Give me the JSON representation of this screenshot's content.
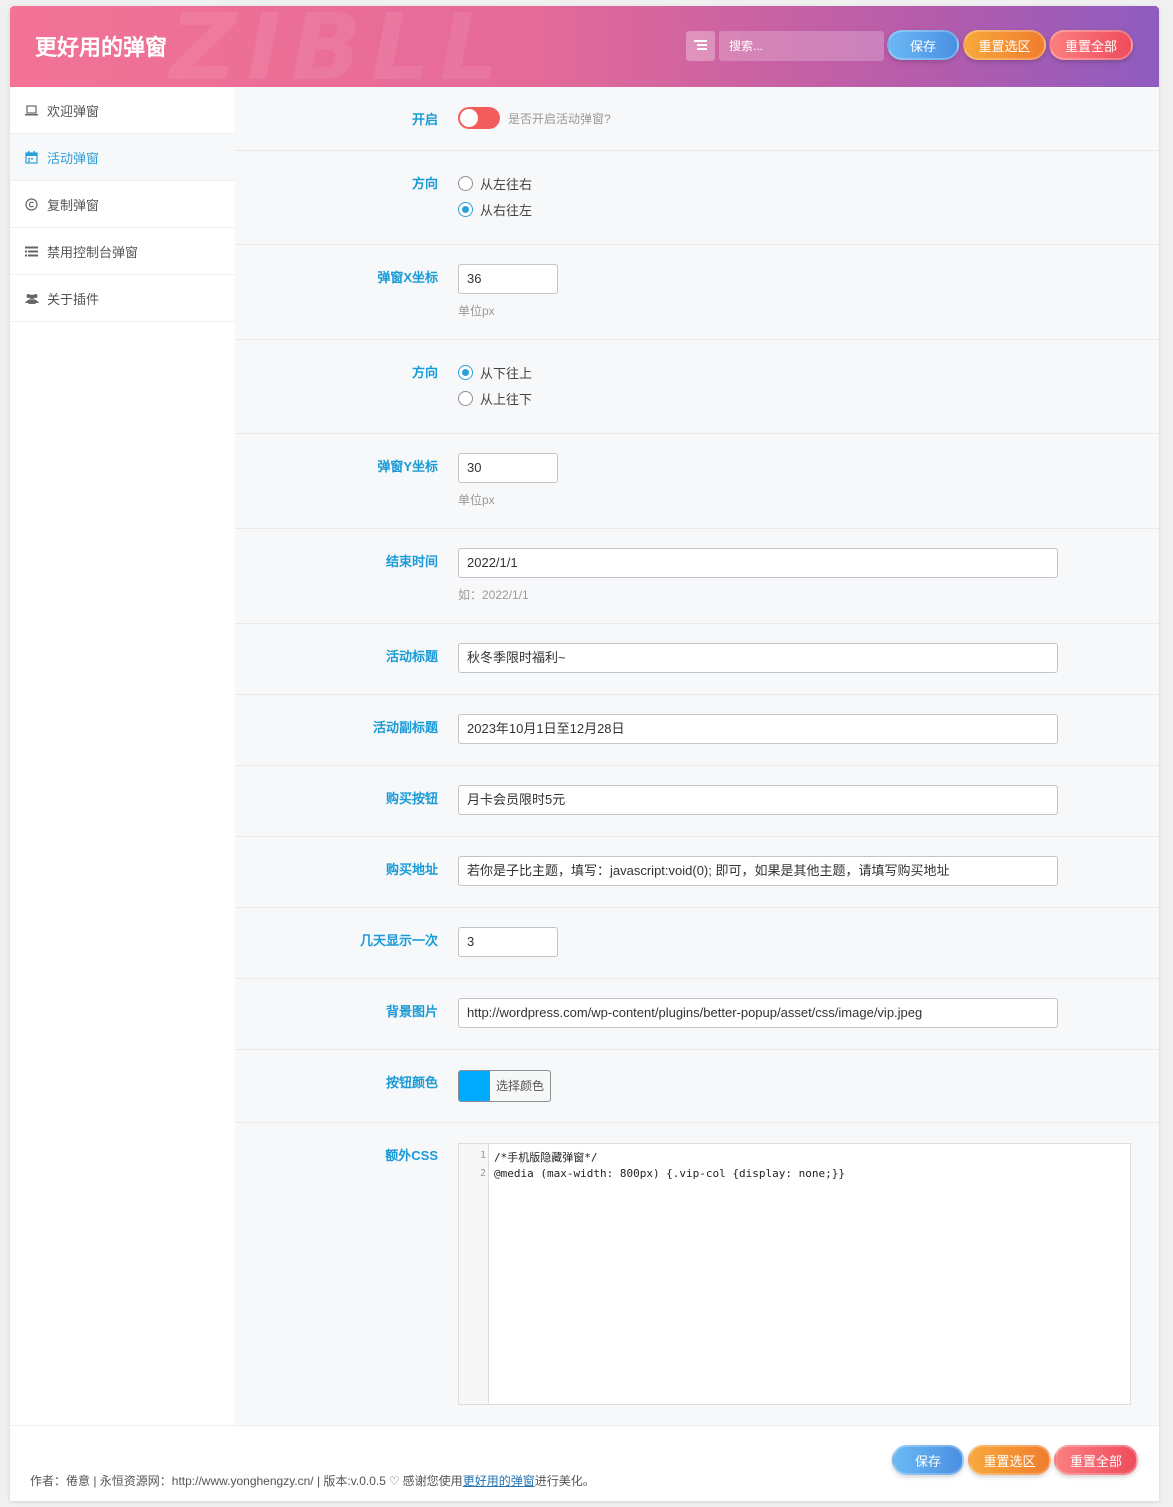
{
  "header": {
    "title": "更好用的弹窗",
    "watermark": "ZIBLL",
    "search_placeholder": "搜索...",
    "save_label": "保存",
    "reset_section_label": "重置选区",
    "reset_all_label": "重置全部"
  },
  "sidebar": {
    "items": [
      {
        "label": "欢迎弹窗",
        "icon": "laptop-icon"
      },
      {
        "label": "活动弹窗",
        "icon": "calendar-icon"
      },
      {
        "label": "复制弹窗",
        "icon": "copyright-icon"
      },
      {
        "label": "禁用控制台弹窗",
        "icon": "list-icon"
      },
      {
        "label": "关于插件",
        "icon": "users-icon"
      }
    ]
  },
  "form": {
    "enable": {
      "label": "开启",
      "desc": "是否开启活动弹窗?",
      "on": false
    },
    "direction_x": {
      "label": "方向",
      "options": [
        "从左往右",
        "从右往左"
      ],
      "selected": 1
    },
    "x_coord": {
      "label": "弹窗X坐标",
      "value": "36",
      "desc": "单位px"
    },
    "direction_y": {
      "label": "方向",
      "options": [
        "从下往上",
        "从上往下"
      ],
      "selected": 0
    },
    "y_coord": {
      "label": "弹窗Y坐标",
      "value": "30",
      "desc": "单位px"
    },
    "end_time": {
      "label": "结束时间",
      "value": "2022/1/1",
      "desc": "如：2022/1/1"
    },
    "activity_title": {
      "label": "活动标题",
      "value": "秋冬季限时福利~"
    },
    "activity_subtitle": {
      "label": "活动副标题",
      "value": "2023年10月1日至12月28日"
    },
    "buy_button": {
      "label": "购买按钮",
      "value": "月卡会员限时5元"
    },
    "buy_url": {
      "label": "购买地址",
      "value": "若你是子比主题，填写：javascript:void(0); 即可，如果是其他主题，请填写购买地址"
    },
    "days_interval": {
      "label": "几天显示一次",
      "value": "3"
    },
    "bg_image": {
      "label": "背景图片",
      "value": "http://wordpress.com/wp-content/plugins/better-popup/asset/css/image/vip.jpeg"
    },
    "button_color": {
      "label": "按钮颜色",
      "picker_label": "选择颜色",
      "color": "#00aaff"
    },
    "extra_css": {
      "label": "额外CSS",
      "line_numbers": [
        "1",
        "2"
      ],
      "lines": [
        "/*手机版隐藏弹窗*/",
        "@media (max-width: 800px) {.vip-col {display: none;}}"
      ]
    }
  },
  "footer": {
    "credit_prefix": "作者：倦意 | 永恒资源网：http://www.yonghengzy.cn/ | 版本:v.0.0.5",
    "credit_thanks": "感谢您使用",
    "credit_link": "更好用的弹窗",
    "credit_suffix": "进行美化。",
    "save_label": "保存",
    "reset_section_label": "重置选区",
    "reset_all_label": "重置全部"
  },
  "colors": {
    "accent": "#1a9bd7",
    "toggle_off": "#f35c5c",
    "header_gradient_start": "#f27396",
    "header_gradient_end": "#8e5cc0"
  }
}
